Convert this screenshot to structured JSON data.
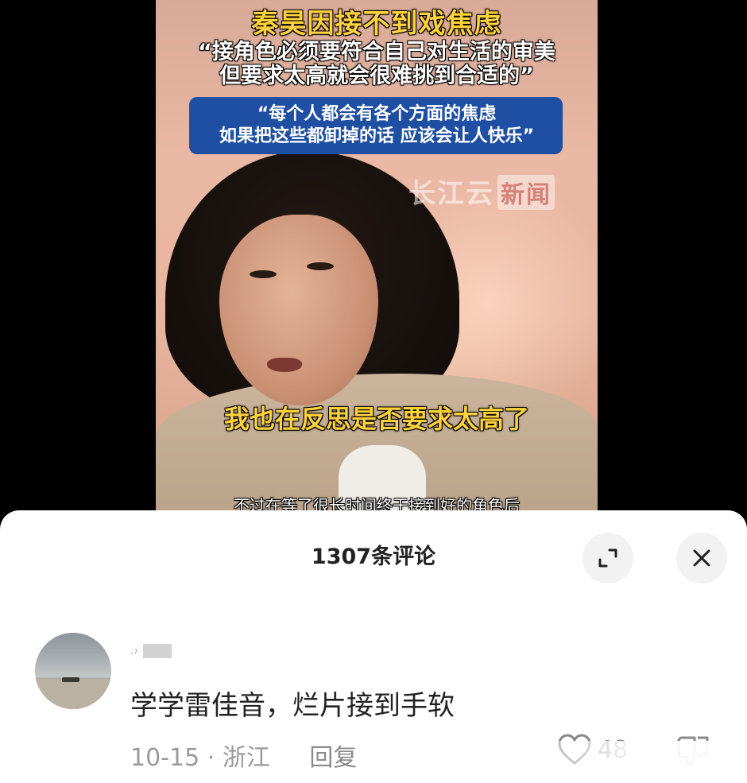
{
  "video": {
    "title": "秦昊因接不到戏焦虑",
    "quote1_line1": "“接角色必须要符合自己对生活的审美",
    "quote1_line2": "但要求太高就会很难挑到合适的”",
    "quote2_line1": "“每个人都会有各个方面的焦虑",
    "quote2_line2": "如果把这些都卸掉的话 应该会让人快乐”",
    "watermark_text": "长江云",
    "watermark_badge": "新闻",
    "subtitle_main": "我也在反思是否要求太高了",
    "subtitle_bottom": "不过在等了很长时间终于接到好的角色后",
    "colors": {
      "title": "#ffd23c",
      "quote_box": "#1e4fa3"
    }
  },
  "comments_sheet": {
    "title": "1307条评论",
    "expand_icon": "expand-icon",
    "close_icon": "close-icon"
  },
  "comment": {
    "username_mark": "·⁷",
    "text": "学学雷佳音，烂片接到手软",
    "date": "10-15",
    "separator": "·",
    "location": "浙江",
    "reply_label": "回复",
    "like_count": "48",
    "like_icon": "heart-icon",
    "dislike_icon": "thumbs-down-icon"
  }
}
